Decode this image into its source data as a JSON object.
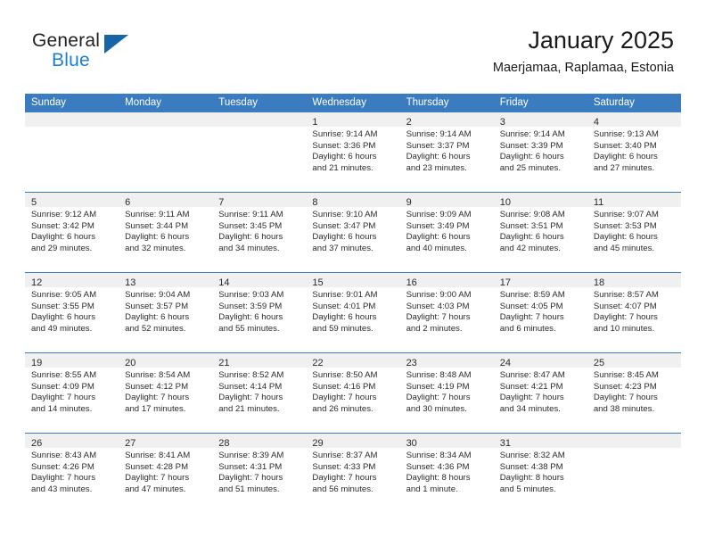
{
  "logo": {
    "word_one": "General",
    "word_two": "Blue",
    "triangle_icon": "blue-triangle-icon"
  },
  "header": {
    "title": "January 2025",
    "subtitle": "Maerjamaa, Raplamaa, Estonia"
  },
  "colors": {
    "header_blue": "#3a7cbf",
    "logo_blue": "#1b7fd1",
    "logo_triangle": "#1565a8",
    "day_band_gray": "#f0f0f0",
    "text": "#2b2b2b"
  },
  "weekday_headers": [
    "Sunday",
    "Monday",
    "Tuesday",
    "Wednesday",
    "Thursday",
    "Friday",
    "Saturday"
  ],
  "weeks": [
    [
      {
        "day": "",
        "empty": true
      },
      {
        "day": "",
        "empty": true
      },
      {
        "day": "",
        "empty": true
      },
      {
        "day": "1",
        "sunrise": "Sunrise: 9:14 AM",
        "sunset": "Sunset: 3:36 PM",
        "daylight_1": "Daylight: 6 hours",
        "daylight_2": "and 21 minutes."
      },
      {
        "day": "2",
        "sunrise": "Sunrise: 9:14 AM",
        "sunset": "Sunset: 3:37 PM",
        "daylight_1": "Daylight: 6 hours",
        "daylight_2": "and 23 minutes."
      },
      {
        "day": "3",
        "sunrise": "Sunrise: 9:14 AM",
        "sunset": "Sunset: 3:39 PM",
        "daylight_1": "Daylight: 6 hours",
        "daylight_2": "and 25 minutes."
      },
      {
        "day": "4",
        "sunrise": "Sunrise: 9:13 AM",
        "sunset": "Sunset: 3:40 PM",
        "daylight_1": "Daylight: 6 hours",
        "daylight_2": "and 27 minutes."
      }
    ],
    [
      {
        "day": "5",
        "sunrise": "Sunrise: 9:12 AM",
        "sunset": "Sunset: 3:42 PM",
        "daylight_1": "Daylight: 6 hours",
        "daylight_2": "and 29 minutes."
      },
      {
        "day": "6",
        "sunrise": "Sunrise: 9:11 AM",
        "sunset": "Sunset: 3:44 PM",
        "daylight_1": "Daylight: 6 hours",
        "daylight_2": "and 32 minutes."
      },
      {
        "day": "7",
        "sunrise": "Sunrise: 9:11 AM",
        "sunset": "Sunset: 3:45 PM",
        "daylight_1": "Daylight: 6 hours",
        "daylight_2": "and 34 minutes."
      },
      {
        "day": "8",
        "sunrise": "Sunrise: 9:10 AM",
        "sunset": "Sunset: 3:47 PM",
        "daylight_1": "Daylight: 6 hours",
        "daylight_2": "and 37 minutes."
      },
      {
        "day": "9",
        "sunrise": "Sunrise: 9:09 AM",
        "sunset": "Sunset: 3:49 PM",
        "daylight_1": "Daylight: 6 hours",
        "daylight_2": "and 40 minutes."
      },
      {
        "day": "10",
        "sunrise": "Sunrise: 9:08 AM",
        "sunset": "Sunset: 3:51 PM",
        "daylight_1": "Daylight: 6 hours",
        "daylight_2": "and 42 minutes."
      },
      {
        "day": "11",
        "sunrise": "Sunrise: 9:07 AM",
        "sunset": "Sunset: 3:53 PM",
        "daylight_1": "Daylight: 6 hours",
        "daylight_2": "and 45 minutes."
      }
    ],
    [
      {
        "day": "12",
        "sunrise": "Sunrise: 9:05 AM",
        "sunset": "Sunset: 3:55 PM",
        "daylight_1": "Daylight: 6 hours",
        "daylight_2": "and 49 minutes."
      },
      {
        "day": "13",
        "sunrise": "Sunrise: 9:04 AM",
        "sunset": "Sunset: 3:57 PM",
        "daylight_1": "Daylight: 6 hours",
        "daylight_2": "and 52 minutes."
      },
      {
        "day": "14",
        "sunrise": "Sunrise: 9:03 AM",
        "sunset": "Sunset: 3:59 PM",
        "daylight_1": "Daylight: 6 hours",
        "daylight_2": "and 55 minutes."
      },
      {
        "day": "15",
        "sunrise": "Sunrise: 9:01 AM",
        "sunset": "Sunset: 4:01 PM",
        "daylight_1": "Daylight: 6 hours",
        "daylight_2": "and 59 minutes."
      },
      {
        "day": "16",
        "sunrise": "Sunrise: 9:00 AM",
        "sunset": "Sunset: 4:03 PM",
        "daylight_1": "Daylight: 7 hours",
        "daylight_2": "and 2 minutes."
      },
      {
        "day": "17",
        "sunrise": "Sunrise: 8:59 AM",
        "sunset": "Sunset: 4:05 PM",
        "daylight_1": "Daylight: 7 hours",
        "daylight_2": "and 6 minutes."
      },
      {
        "day": "18",
        "sunrise": "Sunrise: 8:57 AM",
        "sunset": "Sunset: 4:07 PM",
        "daylight_1": "Daylight: 7 hours",
        "daylight_2": "and 10 minutes."
      }
    ],
    [
      {
        "day": "19",
        "sunrise": "Sunrise: 8:55 AM",
        "sunset": "Sunset: 4:09 PM",
        "daylight_1": "Daylight: 7 hours",
        "daylight_2": "and 14 minutes."
      },
      {
        "day": "20",
        "sunrise": "Sunrise: 8:54 AM",
        "sunset": "Sunset: 4:12 PM",
        "daylight_1": "Daylight: 7 hours",
        "daylight_2": "and 17 minutes."
      },
      {
        "day": "21",
        "sunrise": "Sunrise: 8:52 AM",
        "sunset": "Sunset: 4:14 PM",
        "daylight_1": "Daylight: 7 hours",
        "daylight_2": "and 21 minutes."
      },
      {
        "day": "22",
        "sunrise": "Sunrise: 8:50 AM",
        "sunset": "Sunset: 4:16 PM",
        "daylight_1": "Daylight: 7 hours",
        "daylight_2": "and 26 minutes."
      },
      {
        "day": "23",
        "sunrise": "Sunrise: 8:48 AM",
        "sunset": "Sunset: 4:19 PM",
        "daylight_1": "Daylight: 7 hours",
        "daylight_2": "and 30 minutes."
      },
      {
        "day": "24",
        "sunrise": "Sunrise: 8:47 AM",
        "sunset": "Sunset: 4:21 PM",
        "daylight_1": "Daylight: 7 hours",
        "daylight_2": "and 34 minutes."
      },
      {
        "day": "25",
        "sunrise": "Sunrise: 8:45 AM",
        "sunset": "Sunset: 4:23 PM",
        "daylight_1": "Daylight: 7 hours",
        "daylight_2": "and 38 minutes."
      }
    ],
    [
      {
        "day": "26",
        "sunrise": "Sunrise: 8:43 AM",
        "sunset": "Sunset: 4:26 PM",
        "daylight_1": "Daylight: 7 hours",
        "daylight_2": "and 43 minutes."
      },
      {
        "day": "27",
        "sunrise": "Sunrise: 8:41 AM",
        "sunset": "Sunset: 4:28 PM",
        "daylight_1": "Daylight: 7 hours",
        "daylight_2": "and 47 minutes."
      },
      {
        "day": "28",
        "sunrise": "Sunrise: 8:39 AM",
        "sunset": "Sunset: 4:31 PM",
        "daylight_1": "Daylight: 7 hours",
        "daylight_2": "and 51 minutes."
      },
      {
        "day": "29",
        "sunrise": "Sunrise: 8:37 AM",
        "sunset": "Sunset: 4:33 PM",
        "daylight_1": "Daylight: 7 hours",
        "daylight_2": "and 56 minutes."
      },
      {
        "day": "30",
        "sunrise": "Sunrise: 8:34 AM",
        "sunset": "Sunset: 4:36 PM",
        "daylight_1": "Daylight: 8 hours",
        "daylight_2": "and 1 minute."
      },
      {
        "day": "31",
        "sunrise": "Sunrise: 8:32 AM",
        "sunset": "Sunset: 4:38 PM",
        "daylight_1": "Daylight: 8 hours",
        "daylight_2": "and 5 minutes."
      },
      {
        "day": "",
        "empty": true
      }
    ]
  ]
}
